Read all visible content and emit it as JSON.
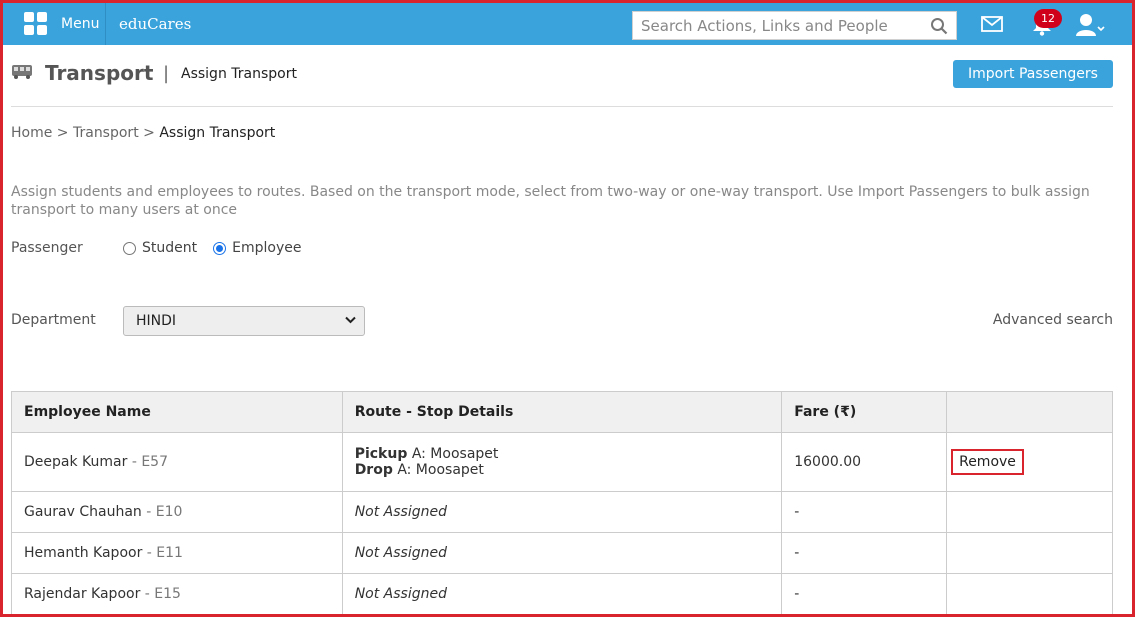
{
  "topbar": {
    "menu_label": "Menu",
    "brand": "eduCares",
    "search_placeholder": "Search Actions, Links and People",
    "notification_count": "12"
  },
  "header": {
    "title": "Transport",
    "separator": "|",
    "subtitle": "Assign Transport",
    "import_button": "Import Passengers"
  },
  "breadcrumb": {
    "home": "Home",
    "sep": ">",
    "transport": "Transport",
    "current": "Assign Transport"
  },
  "description": "Assign students and employees to routes. Based on the transport mode, select from two-way or one-way transport. Use Import Passengers to bulk assign transport to many users at once",
  "passenger": {
    "label": "Passenger",
    "options": [
      "Student",
      "Employee"
    ],
    "selected": "Employee"
  },
  "department": {
    "label": "Department",
    "value": "HINDI",
    "advanced_search": "Advanced search"
  },
  "table": {
    "headers": [
      "Employee Name",
      "Route - Stop Details",
      "Fare (₹)",
      ""
    ],
    "rows": [
      {
        "name": "Deepak Kumar",
        "code": "- E57",
        "pickup_label": "Pickup",
        "pickup": "A: Moosapet",
        "drop_label": "Drop",
        "drop": "A: Moosapet",
        "fare": "16000.00",
        "action": "Remove"
      },
      {
        "name": "Gaurav Chauhan",
        "code": "- E10",
        "route": "Not Assigned",
        "fare": "-"
      },
      {
        "name": "Hemanth Kapoor",
        "code": "- E11",
        "route": "Not Assigned",
        "fare": "-"
      },
      {
        "name": "Rajendar Kapoor",
        "code": "- E15",
        "route": "Not Assigned",
        "fare": "-"
      }
    ]
  },
  "colors": {
    "topbar": "#3ba3dc",
    "highlight_border": "#d9232d",
    "badge": "#d0021b"
  }
}
